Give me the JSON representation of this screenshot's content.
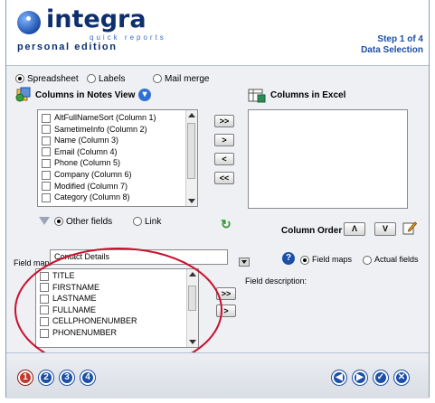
{
  "header": {
    "logo_main": "integra",
    "logo_sub": "quick reports",
    "logo_edition": "personal edition",
    "step": "Step 1 of 4",
    "step_title": "Data Selection"
  },
  "source_type": {
    "options": [
      "Spreadsheet",
      "Labels",
      "Mail merge"
    ],
    "selected": "Spreadsheet"
  },
  "notes_view": {
    "title": "Columns in Notes View",
    "columns": [
      "AltFullNameSort (Column 1)",
      "SametimeInfo (Column 2)",
      "Name (Column 3)",
      "Email (Column 4)",
      "Phone (Column 5)",
      "Company (Column 6)",
      "Modified (Column 7)",
      "Category (Column 8)"
    ]
  },
  "excel": {
    "title": "Columns in Excel",
    "columns": []
  },
  "transfer_buttons": {
    "add_all": ">>",
    "add": ">",
    "remove": "<",
    "remove_all": "<<"
  },
  "other_fields": {
    "options": [
      "Other fields",
      "Link"
    ],
    "selected": "Other fields"
  },
  "column_order": {
    "label": "Column Order",
    "up": "Λ",
    "down": "V"
  },
  "field_map": {
    "label": "Field map:",
    "value": "Contact Details",
    "fields": [
      "TITLE",
      "FIRSTNAME",
      "LASTNAME",
      "FULLNAME",
      "CELLPHONENUMBER",
      "PHONENUMBER"
    ],
    "add_all": ">>",
    "add": ">"
  },
  "field_mode": {
    "options": [
      "Field maps",
      "Actual fields"
    ],
    "selected": "Field maps"
  },
  "field_description": {
    "label": "Field description:"
  },
  "footer": {
    "steps": [
      "1",
      "2",
      "3",
      "4"
    ],
    "nav": [
      "back",
      "next",
      "finish",
      "cancel"
    ]
  },
  "colors": {
    "brand": "#0d2f6e",
    "accent": "#1c4fa8",
    "annotation": "#c8102e",
    "step1": "#c0392b"
  }
}
